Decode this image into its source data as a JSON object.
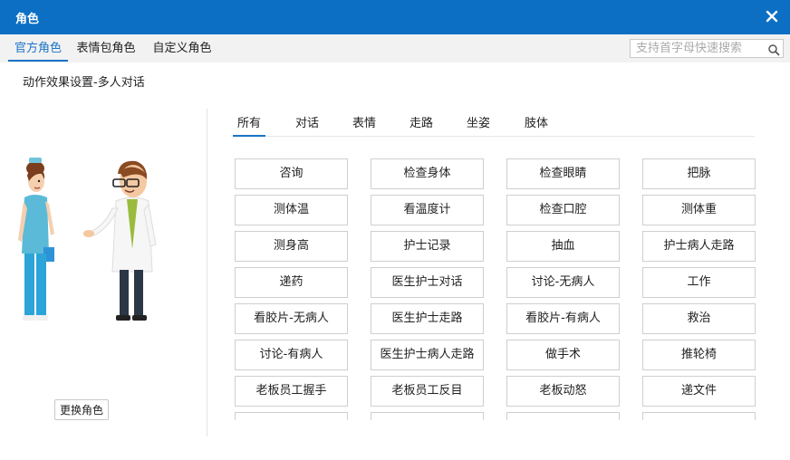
{
  "window": {
    "title": "角色"
  },
  "tabs": [
    {
      "label": "官方角色",
      "active": true
    },
    {
      "label": "表情包角色",
      "active": false
    },
    {
      "label": "自定义角色",
      "active": false
    }
  ],
  "search": {
    "placeholder": "支持首字母快速搜索",
    "icon": "search-icon"
  },
  "subtitle": "动作效果设置-多人对话",
  "left_panel": {
    "change_button": "更换角色",
    "characters": [
      "nurse",
      "doctor"
    ]
  },
  "filters": [
    {
      "label": "所有",
      "active": true
    },
    {
      "label": "对话",
      "active": false
    },
    {
      "label": "表情",
      "active": false
    },
    {
      "label": "走路",
      "active": false
    },
    {
      "label": "坐姿",
      "active": false
    },
    {
      "label": "肢体",
      "active": false
    }
  ],
  "actions": [
    "咨询",
    "检查身体",
    "检查眼睛",
    "把脉",
    "测体温",
    "看温度计",
    "检查口腔",
    "测体重",
    "测身高",
    "护士记录",
    "抽血",
    "护士病人走路",
    "递药",
    "医生护士对话",
    "讨论-无病人",
    "工作",
    "看胶片-无病人",
    "医生护士走路",
    "看胶片-有病人",
    "救治",
    "讨论-有病人",
    "医生护士病人走路",
    "做手术",
    "推轮椅",
    "老板员工握手",
    "老板员工反目",
    "老板动怒",
    "递文件",
    "",
    "",
    "",
    ""
  ],
  "colors": {
    "titlebar": "#0d6fc4",
    "accent": "#1a73c8"
  }
}
